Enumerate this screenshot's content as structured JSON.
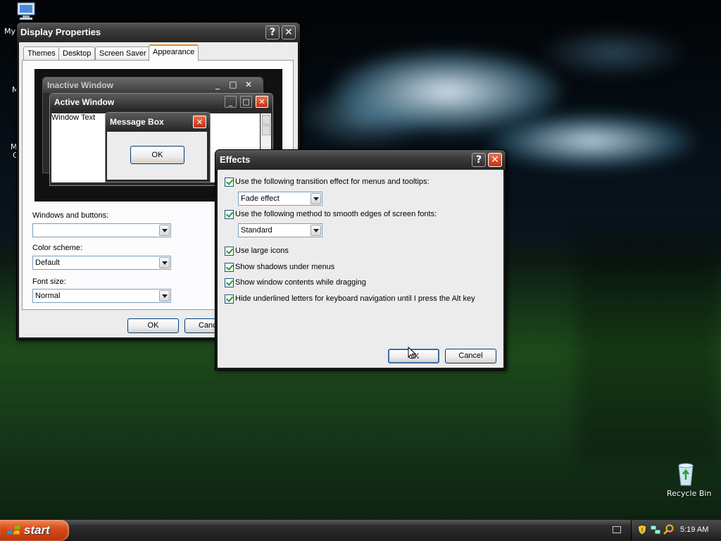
{
  "desktop": {
    "icons": [
      {
        "label": "My"
      },
      {
        "label": "Recycle Bin"
      }
    ],
    "partial_labels": [
      "M",
      "M",
      "C"
    ]
  },
  "display_properties": {
    "title": "Display Properties",
    "help_btn": "?",
    "close_btn": "✕",
    "tabs": [
      "Themes",
      "Desktop",
      "Screen Saver",
      "Appearance"
    ],
    "active_tab": "Appearance",
    "preview": {
      "inactive_title": "Inactive Window",
      "active_title": "Active Window",
      "window_text": "Window Text",
      "msgbox_title": "Message Box",
      "msgbox_ok": "OK"
    },
    "windows_buttons_label": "Windows and buttons:",
    "windows_buttons_value": "",
    "color_scheme_label": "Color scheme:",
    "color_scheme_value": "Default",
    "font_size_label": "Font size:",
    "font_size_value": "Normal",
    "ok": "OK",
    "cancel": "Canc"
  },
  "effects": {
    "title": "Effects",
    "help_btn": "?",
    "close_btn": "✕",
    "options": [
      {
        "label": "Use the following transition effect for menus and tooltips:",
        "checked": true
      },
      {
        "label": "Use the following method to smooth edges of screen fonts:",
        "checked": true
      },
      {
        "label": "Use large icons",
        "checked": true
      },
      {
        "label": "Show shadows under menus",
        "checked": true
      },
      {
        "label": "Show window contents while dragging",
        "checked": true
      },
      {
        "label": "Hide underlined letters for keyboard navigation until I press the Alt key",
        "checked": true
      }
    ],
    "transition_value": "Fade effect",
    "smoothing_value": "Standard",
    "ok": "OK",
    "cancel": "Cancel"
  },
  "taskbar": {
    "start": "start",
    "clock": "5:19 AM"
  },
  "colors": {
    "xp_title_dark": "#262626",
    "close_red": "#c03010",
    "tab_accent": "#e68b2c",
    "start_orange": "#d84d1a"
  }
}
